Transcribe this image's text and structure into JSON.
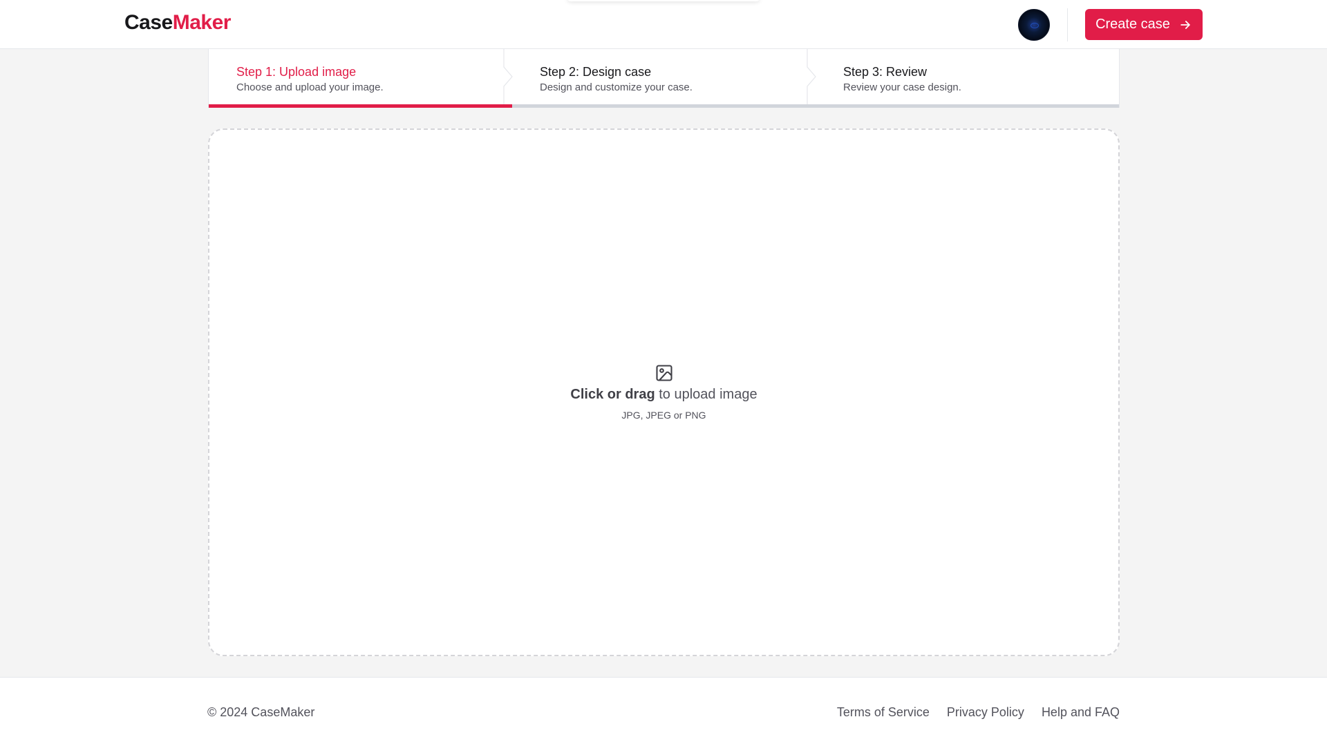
{
  "header": {
    "logo_part1": "Case",
    "logo_part2": "Maker",
    "create_button": "Create case",
    "brand_color": "#e11d48"
  },
  "steps": [
    {
      "title": "Step 1: Upload image",
      "description": "Choose and upload your image.",
      "active": true
    },
    {
      "title": "Step 2: Design case",
      "description": "Design and customize your case.",
      "active": false
    },
    {
      "title": "Step 3: Review",
      "description": "Review your case design.",
      "active": false
    }
  ],
  "dropzone": {
    "bold_text": "Click or drag",
    "text": " to upload image",
    "hint": "JPG, JPEG or PNG",
    "icon": "image-icon"
  },
  "footer": {
    "copyright": "© 2024 CaseMaker",
    "links": [
      "Terms of Service",
      "Privacy Policy",
      "Help and FAQ"
    ]
  }
}
